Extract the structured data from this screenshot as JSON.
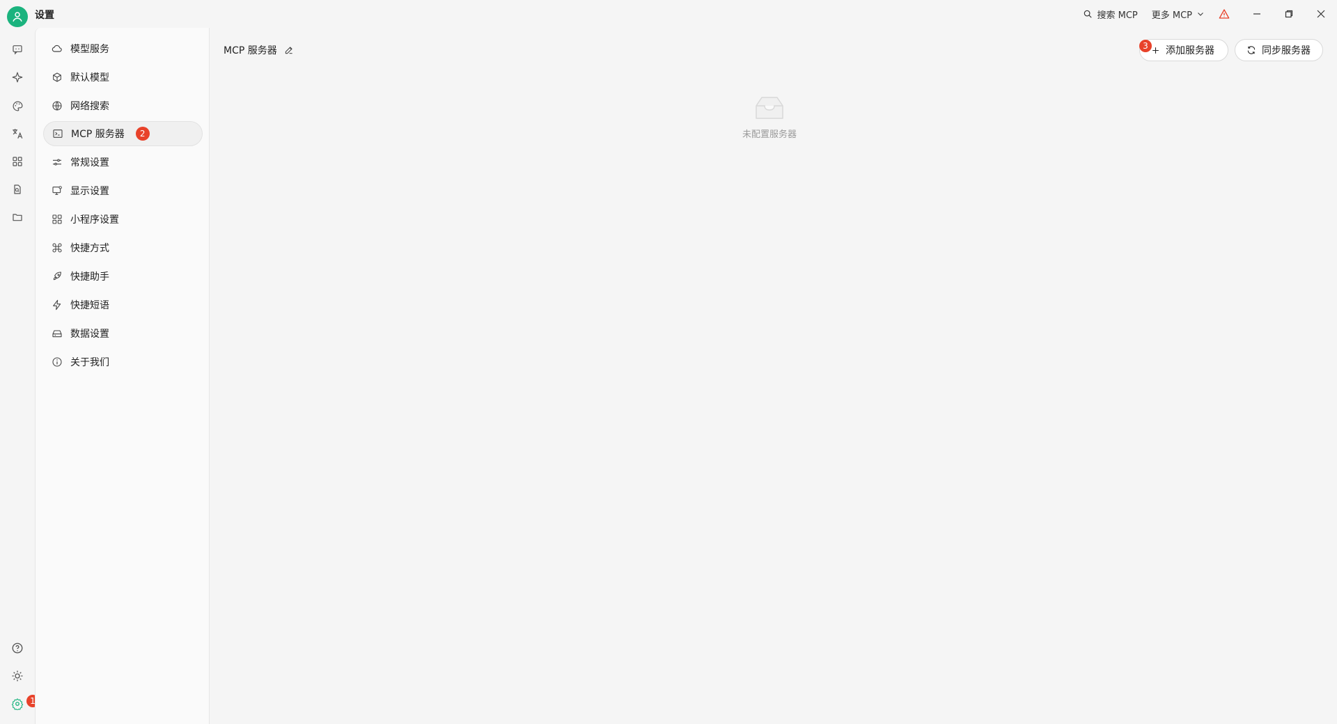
{
  "window": {
    "title": "设置",
    "search_label": "搜索 MCP",
    "more_label": "更多 MCP"
  },
  "rail": {
    "settings_badge": "1",
    "items": [
      "chat-icon",
      "sparkle-icon",
      "palette-icon",
      "translate-icon",
      "apps-icon",
      "file-search-icon",
      "folder-icon"
    ],
    "bottom": [
      "help-icon",
      "theme-icon",
      "settings-icon"
    ]
  },
  "nav": {
    "items": [
      {
        "label": "模型服务",
        "icon": "cloud-icon"
      },
      {
        "label": "默认模型",
        "icon": "cube-icon"
      },
      {
        "label": "网络搜索",
        "icon": "globe-icon"
      },
      {
        "label": "MCP 服务器",
        "icon": "terminal-icon",
        "badge": "2"
      },
      {
        "label": "常规设置",
        "icon": "sliders-icon"
      },
      {
        "label": "显示设置",
        "icon": "monitor-icon"
      },
      {
        "label": "小程序设置",
        "icon": "grid-icon"
      },
      {
        "label": "快捷方式",
        "icon": "command-icon"
      },
      {
        "label": "快捷助手",
        "icon": "rocket-icon"
      },
      {
        "label": "快捷短语",
        "icon": "zap-icon"
      },
      {
        "label": "数据设置",
        "icon": "drive-icon"
      },
      {
        "label": "关于我们",
        "icon": "info-icon"
      }
    ]
  },
  "main": {
    "title": "MCP 服务器",
    "add_button": "添加服务器",
    "add_badge": "3",
    "sync_button": "同步服务器",
    "empty_text": "未配置服务器"
  },
  "colors": {
    "accent": "#1bb37e",
    "badge": "#e8422a",
    "warning": "#e8422a"
  }
}
